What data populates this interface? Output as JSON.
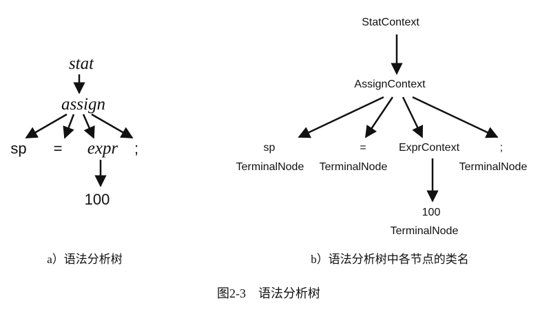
{
  "tree_a": {
    "root": "stat",
    "child": "assign",
    "leaves": [
      "sp",
      "=",
      "expr",
      ";"
    ],
    "grandchild": "100",
    "caption": "a）语法分析树"
  },
  "tree_b": {
    "root": "StatContext",
    "child": "AssignContext",
    "leaf_texts": [
      "sp",
      "=",
      "ExprContext",
      ";"
    ],
    "leaf_types": [
      "TerminalNode",
      "TerminalNode",
      "TerminalNode"
    ],
    "grandchild_text": "100",
    "grandchild_type": "TerminalNode",
    "caption": "b）语法分析树中各节点的类名"
  },
  "figure_caption": "图2-3　语法分析树",
  "colors": {
    "ink": "#111111",
    "background": "#ffffff"
  }
}
